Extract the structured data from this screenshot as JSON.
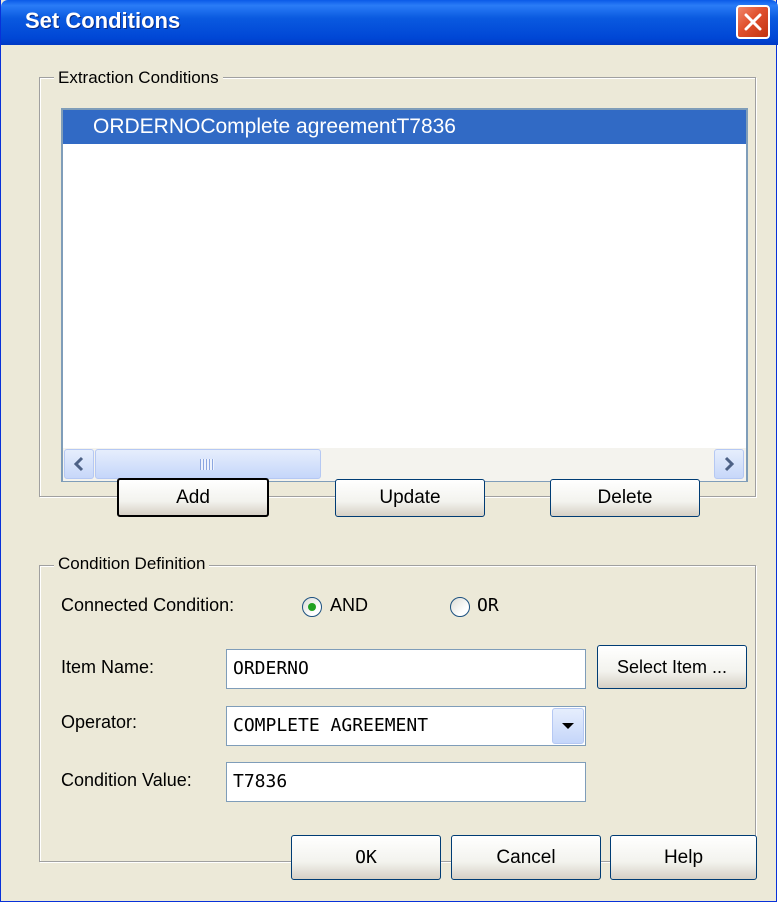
{
  "window": {
    "title": "Set Conditions"
  },
  "extraction": {
    "group_label": "Extraction Conditions",
    "items": [
      {
        "label": "ORDERNOComplete agreementT7836",
        "selected": true
      }
    ]
  },
  "list_buttons": {
    "add": "Add",
    "update": "Update",
    "delete": "Delete"
  },
  "definition": {
    "group_label": "Condition Definition",
    "connected_label": "Connected Condition:",
    "radio_and": "AND",
    "radio_or": "OR",
    "connected_selected": "AND",
    "item_name_label": "Item Name:",
    "item_name_value": "ORDERNO",
    "select_item_button": "Select Item ...",
    "operator_label": "Operator:",
    "operator_value": "COMPLETE AGREEMENT",
    "condition_value_label": "Condition Value:",
    "condition_value": "T7836"
  },
  "footer": {
    "ok": "OK",
    "cancel": "Cancel",
    "help": "Help"
  },
  "colors": {
    "titlebar": "#0a5ae0",
    "selection": "#316ac5",
    "dialog_bg": "#ece9d8",
    "close_button": "#e0502d"
  },
  "icons": [
    "close-icon",
    "scroll-left-icon",
    "scroll-right-icon",
    "dropdown-arrow-icon",
    "radio-dot-icon"
  ]
}
